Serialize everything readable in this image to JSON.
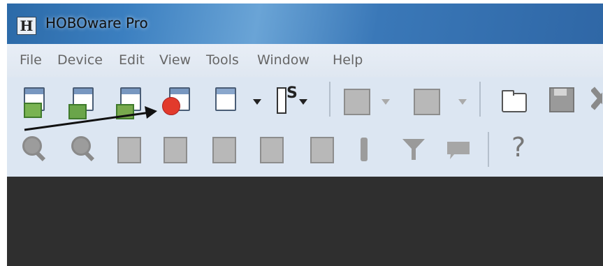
{
  "app": {
    "title": "HOBOware Pro",
    "logo_letter": "H"
  },
  "menu": {
    "items": [
      "File",
      "Device",
      "Edit",
      "View",
      "Tools",
      "Window",
      "Help"
    ]
  },
  "toolbar": {
    "row1": [
      "readout-icon",
      "launch-icon",
      "open-file-icon",
      "record-icon",
      "properties-icon",
      "status-icon",
      "plot-icon",
      "plot-setup-icon",
      "folder-icon",
      "save-icon",
      "close-icon"
    ],
    "row2": [
      "zoom-in-icon",
      "zoom-out-icon",
      "select-icon",
      "edit-icon",
      "view-icon",
      "table-icon",
      "graph-icon",
      "marker-icon",
      "filter-icon",
      "chat-icon",
      "help-icon"
    ],
    "status_icon_text": "S",
    "help_glyph": "?"
  },
  "colors": {
    "record": "#e23a2c",
    "arrow": "#111111"
  }
}
